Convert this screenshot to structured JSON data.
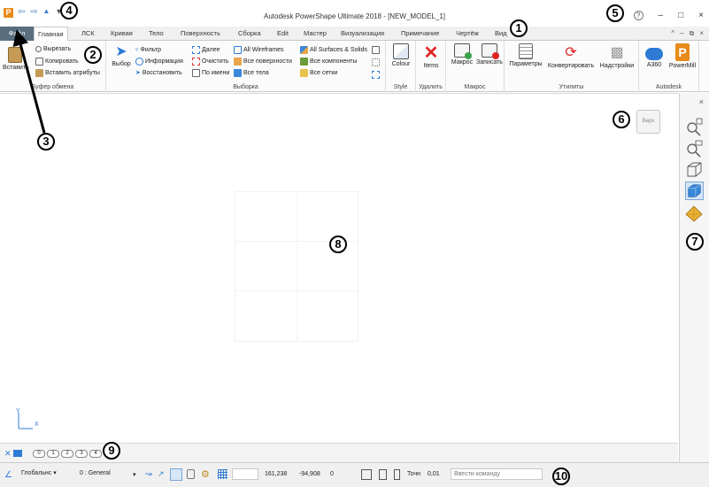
{
  "window": {
    "title": "Autodesk PowerShape Ultimate 2018 - [NEW_MODEL_1]",
    "minimize": "–",
    "maximize": "□",
    "close": "×",
    "help": "?"
  },
  "qat": {
    "undo": "⇦",
    "redo": "⇨",
    "select": "▲",
    "more": "▾"
  },
  "tabs": [
    {
      "label": "Файл"
    },
    {
      "label": "Главная"
    },
    {
      "label": "ЛСК"
    },
    {
      "label": "Кривая"
    },
    {
      "label": "Тело"
    },
    {
      "label": "Поверхность"
    },
    {
      "label": "Сборка"
    },
    {
      "label": "Edit"
    },
    {
      "label": "Мастер"
    },
    {
      "label": "Визуализация"
    },
    {
      "label": "Примечание"
    },
    {
      "label": "Чертёж"
    },
    {
      "label": "Вид"
    }
  ],
  "ribbon_ctrl": {
    "collapse": "^",
    "minimize": "–",
    "restore": "⧉",
    "close": "×"
  },
  "ribbon": {
    "clipboard": {
      "label": "Буфер обмена",
      "paste": "Вставить",
      "cut": "Вырезать",
      "copy": "Копировать",
      "paste_attrs": "Вставить атрибуты"
    },
    "selection": {
      "label": "Выборка",
      "select": "Выбор",
      "filter": "Фильтр",
      "info": "Информация",
      "restore": "Восстановить",
      "next": "Далее",
      "clear": "Очистить",
      "by_name": "По имени",
      "all_wireframes": "All Wireframes",
      "all_surfaces": "Все поверхности",
      "all_solids_body": "Все тела",
      "all_surf_solids": "All Surfaces & Solids",
      "all_components": "Все компоненты",
      "all_meshes": "Все сетки"
    },
    "style": {
      "label": "Style",
      "colour": "Colour"
    },
    "delete": {
      "label": "Удалить",
      "items": "Items"
    },
    "macro": {
      "label": "Макрос",
      "macro": "Макрос",
      "record": "Записать"
    },
    "utilities": {
      "label": "Утилиты",
      "params": "Параметры",
      "convert": "Конвертировать",
      "addins": "Надстройки"
    },
    "autodesk": {
      "label": "Autodesk",
      "a360": "A360",
      "powermill": "PowerMill"
    }
  },
  "viewport": {
    "view_cube": "Верх",
    "axis_y": "Y",
    "axis_x": "X"
  },
  "right_panel": {
    "close": "×"
  },
  "levels": [
    "0",
    "1",
    "2",
    "3",
    "4"
  ],
  "status": {
    "workplane": "Глобальнс",
    "level": "0 : General",
    "x": "161,238",
    "y": "-94,908",
    "z": "0",
    "tolerance_label": "Точн",
    "tolerance": "0,01",
    "command_placeholder": "Ввести команду"
  },
  "callouts": [
    "1",
    "2",
    "3",
    "4",
    "5",
    "6",
    "7",
    "8",
    "9",
    "10"
  ],
  "colors": {
    "file_tab": "#5a6e7e",
    "accent_blue": "#2e7bd6",
    "delete_red": "#e02424",
    "logo_orange": "#e88a1a"
  }
}
